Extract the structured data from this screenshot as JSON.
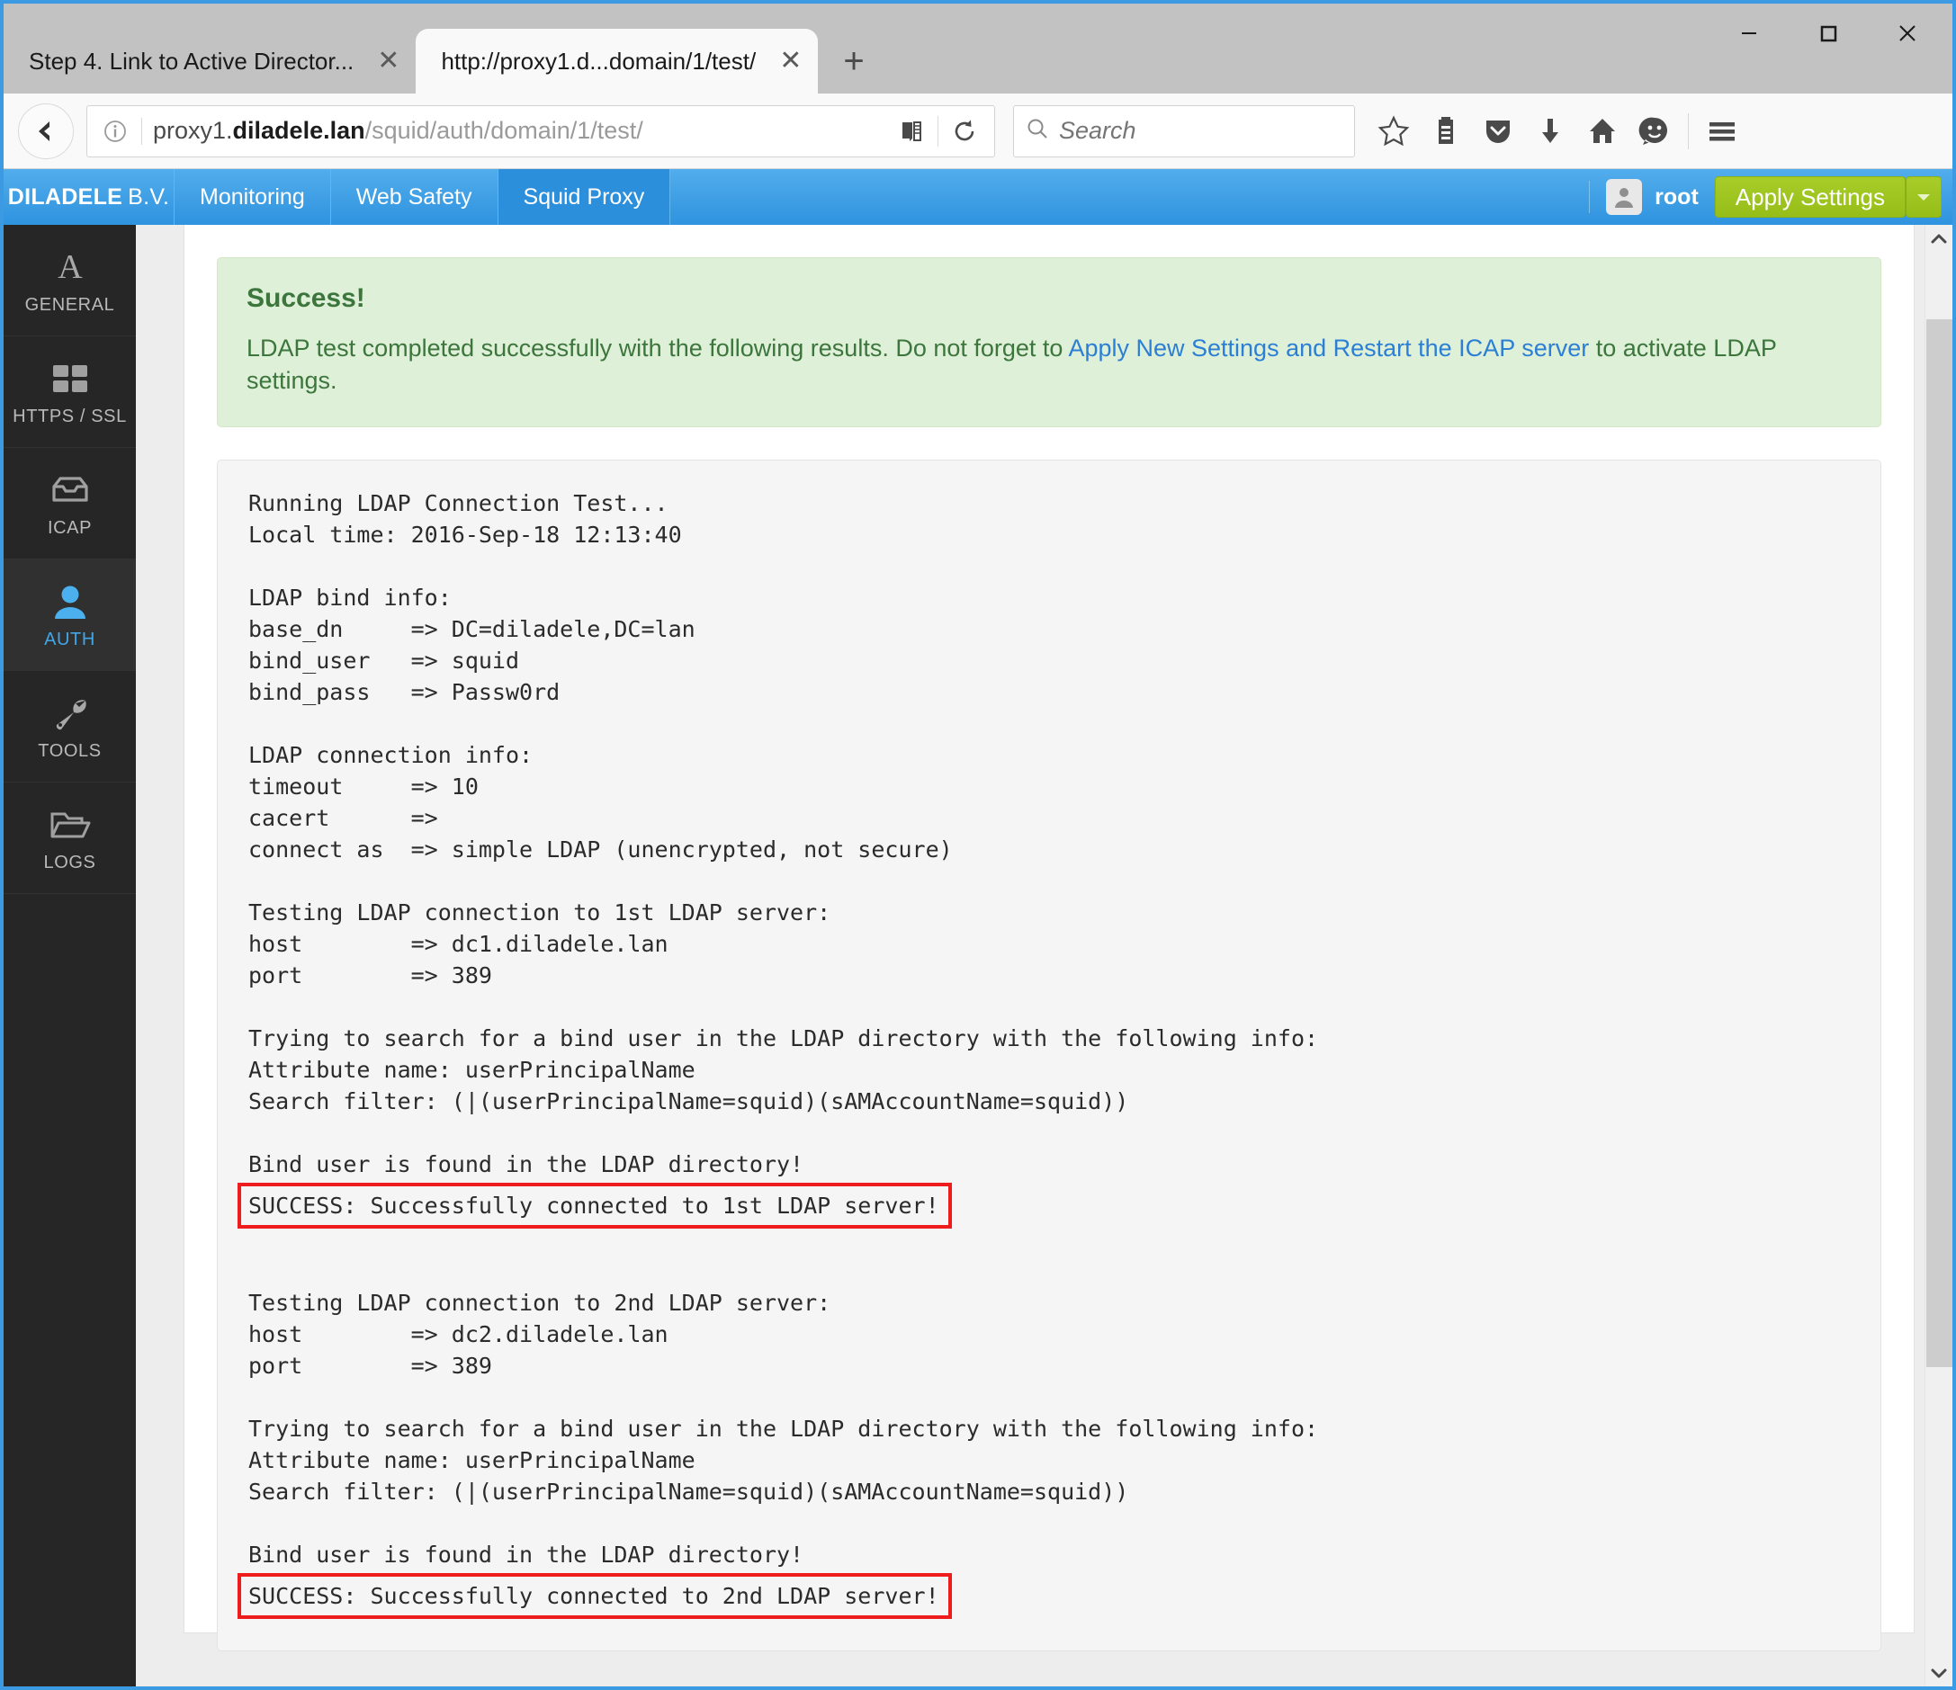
{
  "window": {
    "minimize_label": "Minimize",
    "maximize_label": "Maximize",
    "close_label": "Close"
  },
  "browser": {
    "tabs": [
      {
        "title": "Step 4. Link to Active Director...",
        "active": false
      },
      {
        "title": "http://proxy1.d...domain/1/test/",
        "active": true
      }
    ],
    "new_tab_label": "+",
    "tab_close_label": "✕",
    "url": {
      "host_prefix": "proxy1.",
      "host_bold": "diladele.lan",
      "path": "/squid/auth/domain/1/test/"
    },
    "search": {
      "placeholder": "Search"
    },
    "toolbar_icons": [
      "star-icon",
      "library-icon",
      "pocket-icon",
      "download-icon",
      "home-icon",
      "smiley-icon",
      "hamburger-menu-icon"
    ]
  },
  "appheader": {
    "brand_bold": "DILADELE",
    "brand_light": "B.V.",
    "tabs": [
      {
        "label": "Monitoring",
        "active": false
      },
      {
        "label": "Web Safety",
        "active": false
      },
      {
        "label": "Squid Proxy",
        "active": true
      }
    ],
    "username": "root",
    "apply_label": "Apply Settings",
    "apply_caret": "▼"
  },
  "sidebar": {
    "items": [
      {
        "label": "GENERAL",
        "icon": "letter-a-icon",
        "active": false
      },
      {
        "label": "HTTPS / SSL",
        "icon": "grid-icon",
        "active": false
      },
      {
        "label": "ICAP",
        "icon": "inbox-icon",
        "active": false
      },
      {
        "label": "AUTH",
        "icon": "user-icon",
        "active": true
      },
      {
        "label": "TOOLS",
        "icon": "wrench-icon",
        "active": false
      },
      {
        "label": "LOGS",
        "icon": "folder-icon",
        "active": false
      }
    ]
  },
  "alert": {
    "title": "Success!",
    "body_before": "LDAP test completed successfully with the following results. Do not forget to ",
    "link": "Apply New Settings and Restart the ICAP server",
    "body_after": " to activate LDAP settings."
  },
  "log": {
    "lines": [
      {
        "text": "Running LDAP Connection Test...",
        "highlight": false
      },
      {
        "text": "Local time: 2016-Sep-18 12:13:40",
        "highlight": false
      },
      {
        "text": "",
        "highlight": false
      },
      {
        "text": "LDAP bind info:",
        "highlight": false
      },
      {
        "text": "base_dn     => DC=diladele,DC=lan",
        "highlight": false
      },
      {
        "text": "bind_user   => squid",
        "highlight": false
      },
      {
        "text": "bind_pass   => Passw0rd",
        "highlight": false
      },
      {
        "text": "",
        "highlight": false
      },
      {
        "text": "LDAP connection info:",
        "highlight": false
      },
      {
        "text": "timeout     => 10",
        "highlight": false
      },
      {
        "text": "cacert      =>",
        "highlight": false
      },
      {
        "text": "connect as  => simple LDAP (unencrypted, not secure)",
        "highlight": false
      },
      {
        "text": "",
        "highlight": false
      },
      {
        "text": "Testing LDAP connection to 1st LDAP server:",
        "highlight": false
      },
      {
        "text": "host        => dc1.diladele.lan",
        "highlight": false
      },
      {
        "text": "port        => 389",
        "highlight": false
      },
      {
        "text": "",
        "highlight": false
      },
      {
        "text": "Trying to search for a bind user in the LDAP directory with the following info:",
        "highlight": false
      },
      {
        "text": "Attribute name: userPrincipalName",
        "highlight": false
      },
      {
        "text": "Search filter: (|(userPrincipalName=squid)(sAMAccountName=squid))",
        "highlight": false
      },
      {
        "text": "",
        "highlight": false
      },
      {
        "text": "Bind user is found in the LDAP directory!",
        "highlight": false
      },
      {
        "text": "SUCCESS: Successfully connected to 1st LDAP server!",
        "highlight": true
      },
      {
        "text": "",
        "highlight": false
      },
      {
        "text": "",
        "highlight": false
      },
      {
        "text": "Testing LDAP connection to 2nd LDAP server:",
        "highlight": false
      },
      {
        "text": "host        => dc2.diladele.lan",
        "highlight": false
      },
      {
        "text": "port        => 389",
        "highlight": false
      },
      {
        "text": "",
        "highlight": false
      },
      {
        "text": "Trying to search for a bind user in the LDAP directory with the following info:",
        "highlight": false
      },
      {
        "text": "Attribute name: userPrincipalName",
        "highlight": false
      },
      {
        "text": "Search filter: (|(userPrincipalName=squid)(sAMAccountName=squid))",
        "highlight": false
      },
      {
        "text": "",
        "highlight": false
      },
      {
        "text": "Bind user is found in the LDAP directory!",
        "highlight": false
      },
      {
        "text": "SUCCESS: Successfully connected to 2nd LDAP server!",
        "highlight": true
      }
    ]
  },
  "colors": {
    "brand_blue": "#2f93df",
    "apply_green": "#a8cd2a",
    "alert_bg": "#dff0d8",
    "alert_text": "#3c763d",
    "link_blue": "#2b7fd4",
    "highlight_red": "#ee1c1c",
    "sidebar_bg": "#262626",
    "sidebar_active_text": "#41a6e8"
  }
}
